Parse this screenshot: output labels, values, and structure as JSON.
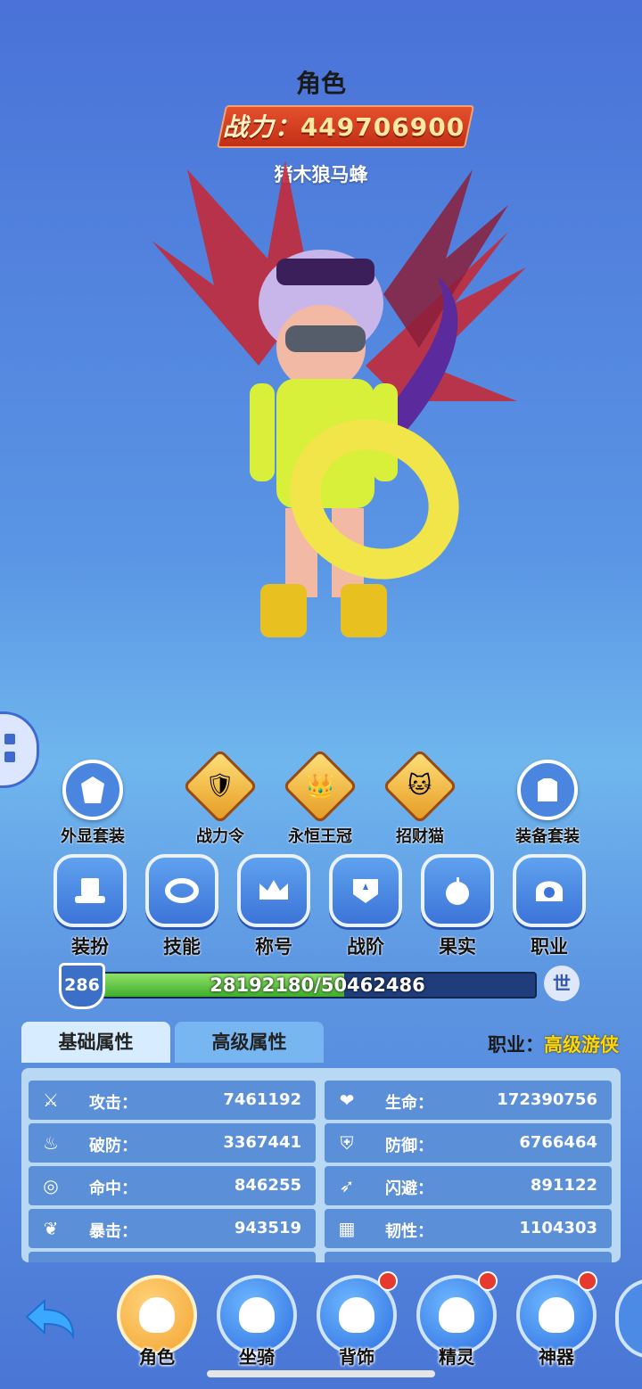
{
  "header": {
    "title": "角色",
    "power_label": "战力：",
    "power_value": "449706900",
    "player_name": "猪木狼马蜂"
  },
  "top_buttons": [
    {
      "label": "外显套装",
      "icon": "costume-set-icon"
    },
    {
      "label": "战力令",
      "icon": "power-order-icon"
    },
    {
      "label": "永恒王冠",
      "icon": "eternal-crown-icon"
    },
    {
      "label": "招财猫",
      "icon": "lucky-cat-icon"
    },
    {
      "label": "装备套装",
      "icon": "equipment-set-icon"
    }
  ],
  "function_buttons": [
    {
      "label": "装扮",
      "icon": "hat-icon"
    },
    {
      "label": "技能",
      "icon": "skill-ring-icon"
    },
    {
      "label": "称号",
      "icon": "crown-icon"
    },
    {
      "label": "战阶",
      "icon": "rank-badge-icon"
    },
    {
      "label": "果实",
      "icon": "apple-icon"
    },
    {
      "label": "职业",
      "icon": "profession-icon"
    }
  ],
  "level": {
    "value": "286",
    "exp_text": "28192180/50462486",
    "exp_fraction": 0.5587,
    "world_button": "世"
  },
  "tabs": {
    "basic": "基础属性",
    "advanced": "高级属性",
    "active": "basic"
  },
  "profession": {
    "label": "职业：",
    "value": "高级游侠"
  },
  "stats": [
    {
      "name": "攻击：",
      "value": "7461192",
      "icon": "sword-icon"
    },
    {
      "name": "生命：",
      "value": "172390756",
      "icon": "heart-icon"
    },
    {
      "name": "破防：",
      "value": "3367441",
      "icon": "flame-icon"
    },
    {
      "name": "防御：",
      "value": "6766464",
      "icon": "shield-icon"
    },
    {
      "name": "命中：",
      "value": "846255",
      "icon": "target-icon"
    },
    {
      "name": "闪避：",
      "value": "891122",
      "icon": "dodge-icon"
    },
    {
      "name": "暴击：",
      "value": "943519",
      "icon": "crit-icon"
    },
    {
      "name": "韧性：",
      "value": "1104303",
      "icon": "tenacity-icon"
    }
  ],
  "bottom_nav": [
    {
      "label": "角色",
      "active": true,
      "dot": false,
      "icon": "helmet-icon"
    },
    {
      "label": "坐骑",
      "active": false,
      "dot": false,
      "icon": "mount-icon"
    },
    {
      "label": "背饰",
      "active": false,
      "dot": true,
      "icon": "wings-icon"
    },
    {
      "label": "精灵",
      "active": false,
      "dot": true,
      "icon": "spirit-icon"
    },
    {
      "label": "神器",
      "active": false,
      "dot": true,
      "icon": "artifact-icon"
    }
  ],
  "colors": {
    "power_plate": "#d2401f",
    "power_text": "#ffe9a2",
    "profession_value": "#ffd700",
    "stat_row": "#5b8fd8",
    "exp_fill": "#3fae2a",
    "badge_dot": "#e63a2e"
  }
}
